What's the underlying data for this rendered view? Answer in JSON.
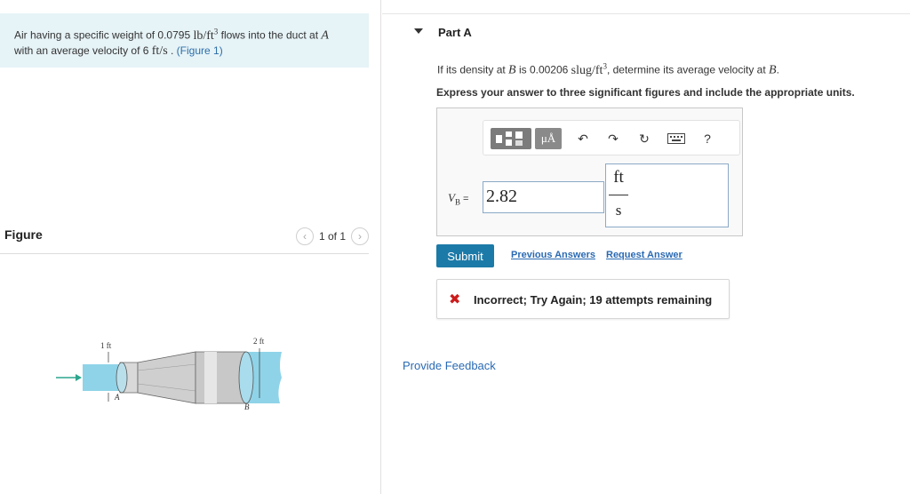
{
  "problem": {
    "text_1": "Air having a specific weight of 0.0795 ",
    "unit_1": "lb/ft",
    "unit_1_exp": "3",
    "text_2": " flows into the duct at ",
    "point_a": "A",
    "text_3": "with an average velocity of 6 ",
    "unit_2": "ft/s",
    "text_4": " . ",
    "figure_link": "(Figure 1)"
  },
  "figure": {
    "title": "Figure",
    "pager_text": "1 of 1",
    "prev_icon": "chevron-left-icon",
    "next_icon": "chevron-right-icon",
    "labels": {
      "d1": "1 ft",
      "d2": "2 ft",
      "a": "A",
      "b": "B"
    },
    "colors": {
      "water": "#8fd3e8",
      "metal": "#c8c8c8",
      "arrow": "#2ca58d"
    }
  },
  "part": {
    "title": "Part A",
    "question_1": "If its density at ",
    "point_b": "B",
    "question_2": " is 0.00206 ",
    "density_unit": "slug/ft",
    "density_exp": "3",
    "question_3": ", determine its average velocity at ",
    "point_b2": "B",
    "question_4": ".",
    "instruction": "Express your answer to three significant figures and include the appropriate units."
  },
  "toolbar": {
    "templates_icon": "templates-icon",
    "units_label": "μÅ",
    "undo_icon": "undo-icon",
    "redo_icon": "redo-icon",
    "reset_icon": "reset-icon",
    "keyboard_icon": "keyboard-icon",
    "help_label": "?"
  },
  "answer": {
    "var_label": "V",
    "var_sub": "B",
    "equals": " =",
    "value": "2.82",
    "unit_num": "ft",
    "unit_den": "s"
  },
  "actions": {
    "submit": "Submit",
    "previous_answers": "Previous Answers",
    "request_answer": "Request Answer"
  },
  "feedback": {
    "icon": "x-icon",
    "message": "Incorrect; Try Again; 19 attempts remaining"
  },
  "provide_feedback": "Provide Feedback"
}
